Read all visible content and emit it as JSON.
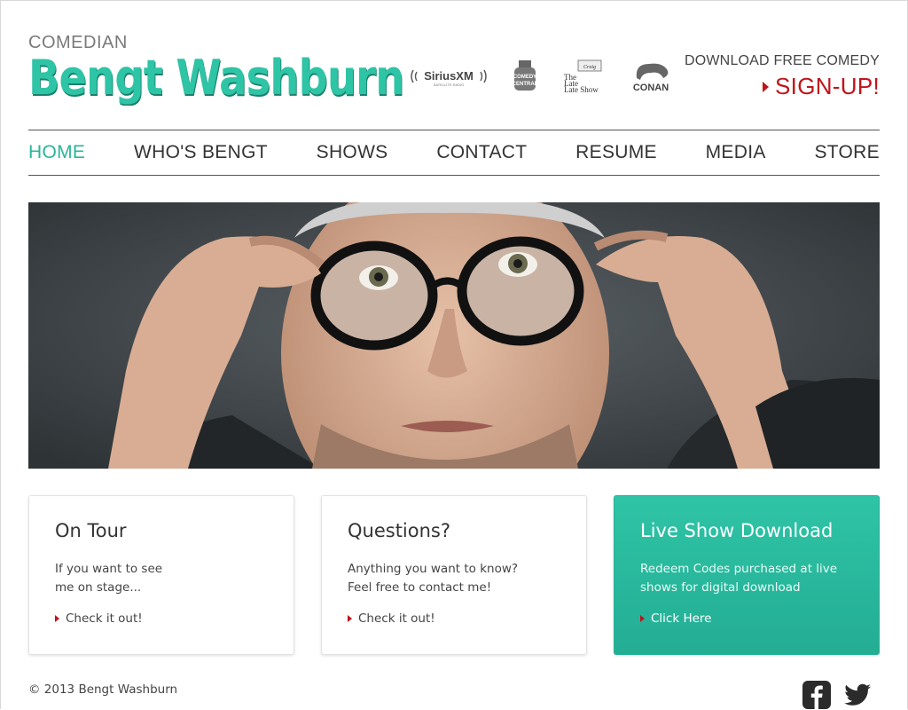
{
  "header": {
    "brand_sub": "COMEDIAN",
    "brand_name": "Bengt Washburn",
    "logos": [
      "siriusxm-logo",
      "comedy-central-logo",
      "late-late-show-logo",
      "conan-logo"
    ],
    "logo_texts": {
      "siriusxm": "SiriusXM",
      "siriusxm_sub": "SATELLITE RADIO",
      "comedy_central": "COMEDY CENTRAL",
      "late_late": "The Late Late Show",
      "conan": "CONAN"
    },
    "promo_line": "DOWNLOAD FREE COMEDY",
    "promo_cta": "SIGN-UP!"
  },
  "nav": {
    "items": [
      "HOME",
      "WHO'S BENGT",
      "SHOWS",
      "CONTACT",
      "RESUME",
      "MEDIA",
      "STORE"
    ],
    "active": "HOME"
  },
  "hero": {
    "image": "portrait-photo"
  },
  "cards": [
    {
      "title": "On Tour",
      "body": "If you want to see\nme on stage...",
      "link": "Check it out!"
    },
    {
      "title": "Questions?",
      "body": "Anything you want to know?\nFeel free to contact me!",
      "link": "Check it out!"
    },
    {
      "title": "Live Show Download",
      "body": "Redeem Codes purchased at live shows for digital download",
      "link": "Click Here"
    }
  ],
  "footer": {
    "copyright": "© 2013 Bengt Washburn",
    "social_icons": [
      "facebook-icon",
      "twitter-icon"
    ]
  },
  "colors": {
    "accent": "#2ec4a6",
    "cta_red": "#c0141b",
    "text": "#333333"
  }
}
